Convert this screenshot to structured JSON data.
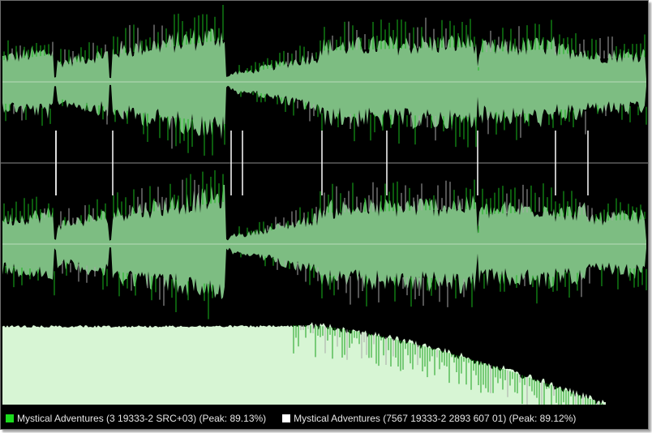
{
  "colors": {
    "background": "#000000",
    "wave_fill": "#7dbd82",
    "wave_peak_a": "#19b81c",
    "wave_peak_b": "#a9a9a9",
    "center_line": "#b9dcbb",
    "divider_line": "#8d8d8d",
    "marker_line": "#ffffff",
    "spectrum_fill": "#d7f5d4",
    "spectrum_peak": "#1aa11d"
  },
  "legend": {
    "series": [
      {
        "label": "Mystical Adventures (3 19333-2 SRC+03) (Peak: 89.13%)",
        "color": "#1bdc1d"
      },
      {
        "label": "Mystical Adventures (7567 19333-2 2893 607 01) (Peak: 89.12%)",
        "color": "#ffffff"
      }
    ]
  },
  "waveform": {
    "channel_count": 2,
    "segment_markers": [
      {
        "label": ""
      },
      {
        "label": ""
      },
      {
        "label": ""
      },
      {
        "label": ""
      },
      {
        "label": ""
      },
      {
        "label": ""
      },
      {
        "label": ""
      },
      {
        "label": ""
      },
      {
        "label": ""
      },
      {
        "label": ""
      }
    ]
  }
}
